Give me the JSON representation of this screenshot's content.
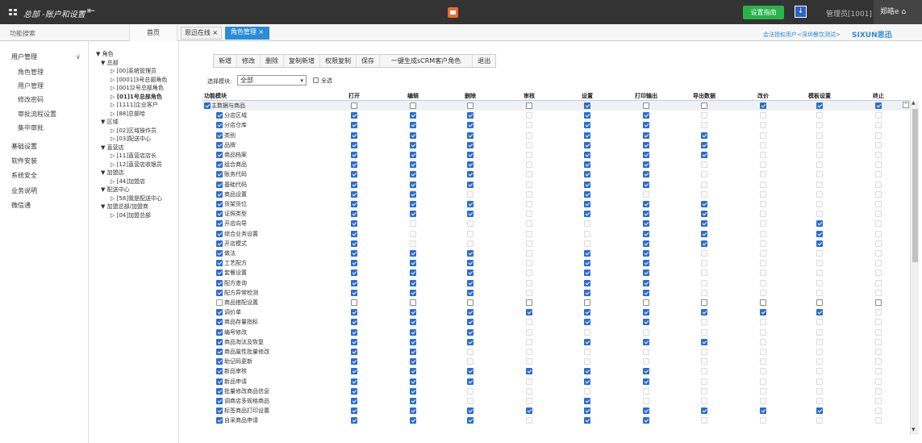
{
  "topbar": {
    "title": "总部 -账户和设置",
    "guide": "设置指南",
    "admin": "管理员[1001]",
    "user": "郑皓e",
    "colors": {
      "bar": "#333333",
      "guide": "#29b24a",
      "accent": "#2a8bd6"
    }
  },
  "subbar": {
    "search": "功能搜索",
    "home": "首页",
    "tabs": [
      "思迅在线 ×",
      "角色管理 ×"
    ],
    "promo": "会法授权用户<深圳餐饮测试>",
    "brand": "SIXUN思迅"
  },
  "sidebar": {
    "sections": [
      {
        "label": "用户管理",
        "items": [
          "角色管理",
          "用户管理",
          "修改密码",
          "审批流程设置",
          "集中审批"
        ]
      },
      {
        "label": "基础设置"
      },
      {
        "label": "软件安装"
      },
      {
        "label": "系统安全"
      },
      {
        "label": "业务说明"
      },
      {
        "label": "微信通"
      }
    ]
  },
  "tree": [
    "▼ 角色",
    "▼ 总部",
    "▷ [00]系统管理员",
    "▷ [0001]3号总部角色",
    "▷ [001]2号总部角色",
    "▷ [01]1号总部角色",
    "▷ [1111]企业客户",
    "▷ [88]总部哈",
    "▼ 区域",
    "▷ [02]区域操作员",
    "▷ [03]配送中心",
    "▼ 直营店",
    "▷ [11]直营店店长",
    "▷ [12]直营店收银员",
    "▼ 加盟店",
    "▷ [44]加盟店",
    "▼ 配送中心",
    "▷ [58]我是配送中心",
    "▼ 加盟总部/加盟商",
    "▷ [04]加盟总部"
  ],
  "toolbar": [
    "新增",
    "修改",
    "删除",
    "复制新增",
    "权限复制",
    "保存",
    "一键生成sCRM客户角色",
    "退出"
  ],
  "filter": {
    "label": "选择模块:",
    "value": "全部",
    "select_all": "全选"
  },
  "grid": {
    "columns": [
      "功能模块",
      "打开",
      "编辑",
      "删除",
      "审核",
      "设置",
      "打印输出",
      "导出数据",
      "改价",
      "模板设置",
      "终止"
    ],
    "rows": [
      {
        "label": "主数据与商品",
        "group": true,
        "v": "0000100111"
      },
      {
        "label": "分店区域",
        "v": "1110110000"
      },
      {
        "label": "分店仓库",
        "v": "1110110000"
      },
      {
        "label": "类别",
        "v": "1110111000"
      },
      {
        "label": "品牌",
        "v": "1110111000"
      },
      {
        "label": "商品档案",
        "v": "1110111000"
      },
      {
        "label": "组合商品",
        "v": "1110110000"
      },
      {
        "label": "账务代码",
        "v": "1110110000"
      },
      {
        "label": "基础代码",
        "v": "1110110000"
      },
      {
        "label": "商品设置",
        "v": "1100100000"
      },
      {
        "label": "货架货位",
        "v": "1110111000"
      },
      {
        "label": "证照类型",
        "v": "1110111000"
      },
      {
        "label": "开店向导",
        "v": "1000011010"
      },
      {
        "label": "综合业务设置",
        "v": "1000011010"
      },
      {
        "label": "开店模式",
        "v": "1000011010"
      },
      {
        "label": "做法",
        "v": "1110110000"
      },
      {
        "label": "工艺配方",
        "v": "1110110000"
      },
      {
        "label": "套餐设置",
        "v": "1110110000"
      },
      {
        "label": "配方查询",
        "v": "1110110000"
      },
      {
        "label": "配方异常检测",
        "v": "1110110000"
      },
      {
        "label": "商品搭配设置",
        "v": "0000000000",
        "unchecked": true
      },
      {
        "label": "调价单",
        "v": "1111111110"
      },
      {
        "label": "商品存量指标",
        "v": "1110110000"
      },
      {
        "label": "编号修改",
        "v": "1110000000"
      },
      {
        "label": "商品淘汰及恢复",
        "v": "1110111000"
      },
      {
        "label": "商品属性批量修改",
        "v": "1100000000"
      },
      {
        "label": "助记码更新",
        "v": "1100000000"
      },
      {
        "label": "新品审核",
        "v": "1111110000"
      },
      {
        "label": "新品申请",
        "v": "1110110000"
      },
      {
        "label": "批量修改商品信息",
        "v": "1100000000"
      },
      {
        "label": "调商店多规格商品",
        "v": "1100100000"
      },
      {
        "label": "标签商品打印设置",
        "v": "1111111110"
      },
      {
        "label": "自采商品申请",
        "v": "1110110000"
      }
    ]
  }
}
